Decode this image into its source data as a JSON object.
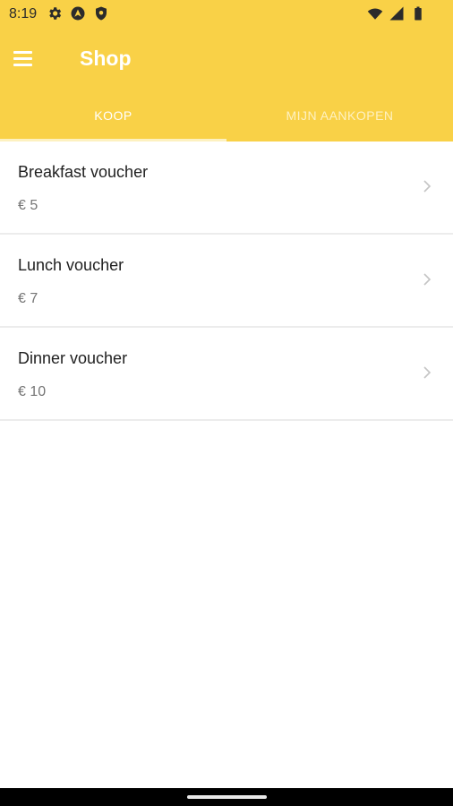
{
  "status_bar": {
    "time": "8:19",
    "left_icons": [
      "settings-icon",
      "nav-app-icon",
      "shield-icon"
    ],
    "right_icons": [
      "wifi-icon",
      "signal-icon",
      "battery-icon"
    ]
  },
  "toolbar": {
    "title": "Shop",
    "menu_icon": "menu-icon"
  },
  "tabs": [
    {
      "label": "KOOP",
      "selected": true
    },
    {
      "label": "MIJN AANKOPEN",
      "selected": false
    }
  ],
  "products": [
    {
      "name": "Breakfast voucher",
      "price": "€ 5"
    },
    {
      "name": "Lunch voucher",
      "price": "€ 7"
    },
    {
      "name": "Dinner voucher",
      "price": "€ 10"
    }
  ],
  "colors": {
    "accent": "#f9d147",
    "text_primary": "#212121",
    "text_secondary": "#757575"
  }
}
